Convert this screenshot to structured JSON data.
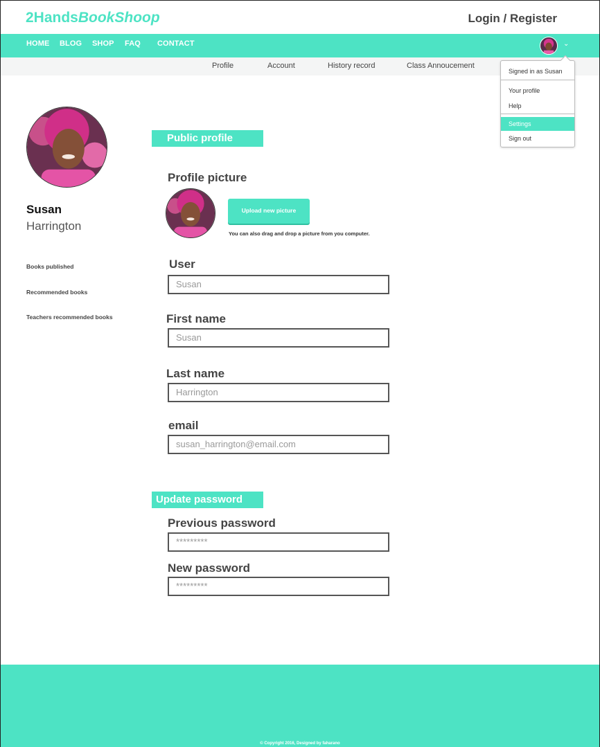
{
  "brand": {
    "part1": "2Hands",
    "part2": "BookShoop"
  },
  "header": {
    "login": "Login / Register"
  },
  "nav": {
    "items": [
      "HOME",
      "BLOG",
      "SHOP",
      "FAQ",
      "CONTACT"
    ]
  },
  "subnav": {
    "items": [
      "Profile",
      "Account",
      "History record",
      "Class Annoucement"
    ]
  },
  "dropdown": {
    "signed_in": "Signed in as Susan",
    "your_profile": "Your profile",
    "help": "Help",
    "settings": "Settings",
    "sign_out": "Sign out"
  },
  "profile": {
    "first": "Susan",
    "last": "Harrington"
  },
  "sidebar": {
    "links": [
      "Books published",
      "Recommended books",
      "Teachers recommended books"
    ]
  },
  "public_profile": {
    "title": "Public profile",
    "picture_label": "Profile picture",
    "upload_button": "Upload new picture",
    "drag_note": "You can also drag and drop a picture from you computer.",
    "user_label": "User",
    "user_placeholder": "Susan",
    "first_label": "First name",
    "first_placeholder": "Susan",
    "last_label": "Last name",
    "last_placeholder": "Harrington",
    "email_label": "email",
    "email_placeholder": "susan_harrington@email.com"
  },
  "password": {
    "title": "Update password",
    "previous_label": "Previous password",
    "previous_placeholder": "*********",
    "new_label": "New password",
    "new_placeholder": "*********"
  },
  "footer": {
    "copyright": "© Copyright 2016, Designed by faharano"
  },
  "colors": {
    "accent": "#4de3c4",
    "subnav_bg": "#f4f5f5",
    "text": "#444444"
  },
  "icons": {
    "avatar": "user-photo",
    "chevron": "chevron-down-icon"
  }
}
